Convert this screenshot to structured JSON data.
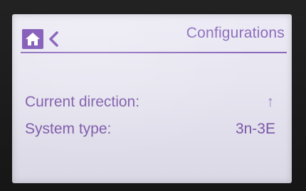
{
  "header": {
    "title": "Configurations",
    "home_icon": "home-icon",
    "back_icon": "chevron-left-icon"
  },
  "rows": [
    {
      "label": "Current direction:",
      "value": "↑"
    },
    {
      "label": "System type:",
      "value": "3n-3E"
    }
  ],
  "colors": {
    "accent": "#7a4fb3",
    "text": "#7a56a8",
    "screen_bg": "#e6e4ef"
  }
}
